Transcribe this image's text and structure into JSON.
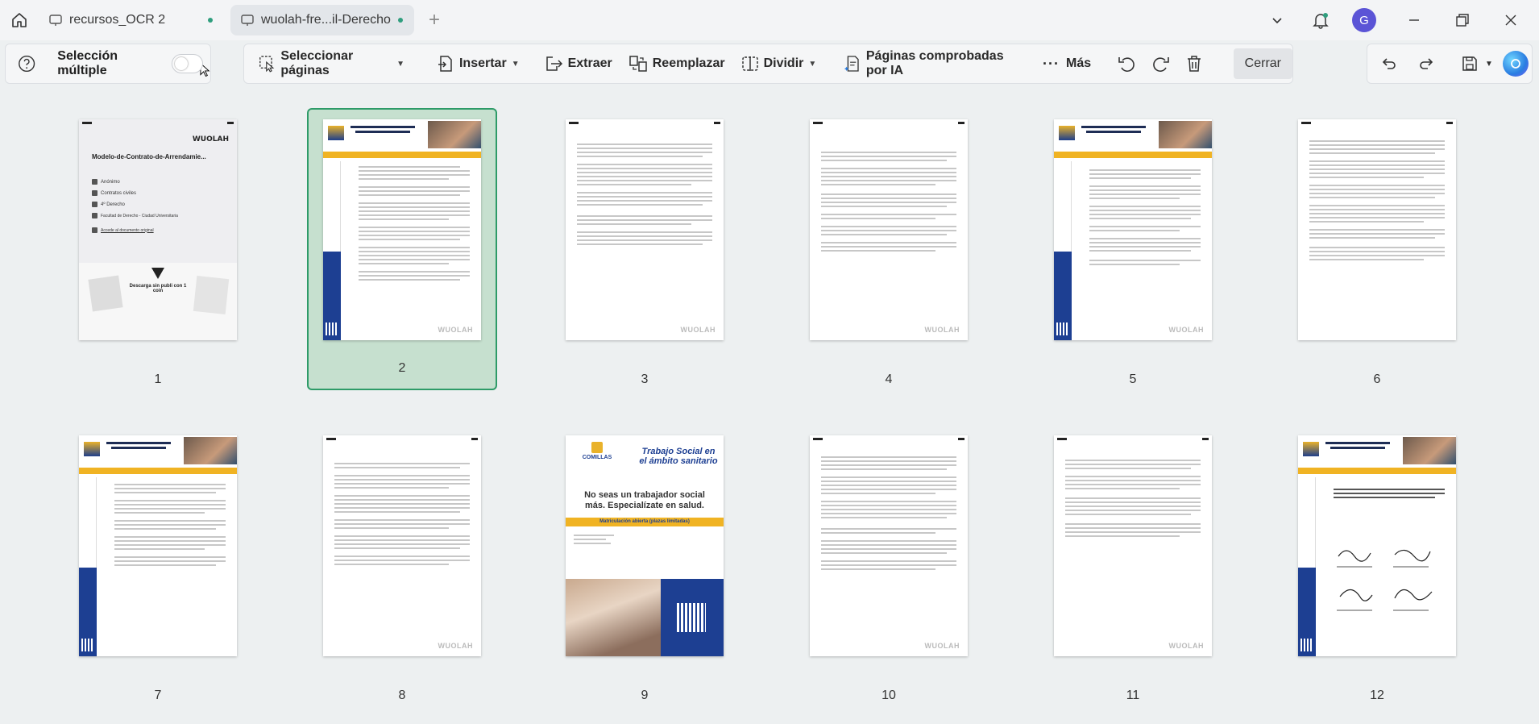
{
  "tabs": [
    {
      "label": "recursos_OCR 2"
    },
    {
      "label": "wuolah-fre...il-Derecho"
    }
  ],
  "avatar_letter": "G",
  "toolbar": {
    "multi_select_label": "Selección múltiple",
    "select_pages": "Seleccionar páginas",
    "insert": "Insertar",
    "extract": "Extraer",
    "replace": "Reemplazar",
    "split": "Dividir",
    "ai_pages": "Páginas comprobadas por IA",
    "more": "Más",
    "close": "Cerrar"
  },
  "pages": [
    {
      "number": "1"
    },
    {
      "number": "2"
    },
    {
      "number": "3"
    },
    {
      "number": "4"
    },
    {
      "number": "5"
    },
    {
      "number": "6"
    },
    {
      "number": "7"
    },
    {
      "number": "8"
    },
    {
      "number": "9"
    },
    {
      "number": "10"
    },
    {
      "number": "11"
    },
    {
      "number": "12"
    }
  ],
  "cover": {
    "brand": "WUOLAH",
    "title": "Modelo-de-Contrato-de-Arrendamie...",
    "items": [
      "Anónimo",
      "Contratos civiles",
      "4º Derecho",
      "Facultad de Derecho - Ciudad Universitaria",
      "Accede al documento original"
    ],
    "footer_text": "Descarga sin publi con 1 coin"
  },
  "ad_page": {
    "brand": "COMILLAS",
    "program": "Trabajo Social en el ámbito sanitario",
    "headline": "No seas un trabajador social más. Especialízate en salud.",
    "band": "Matriculación abierta (plazas limitadas)"
  },
  "colors": {
    "selected_border": "#2e9b68",
    "selected_fill": "#c6e0cf",
    "accent_yellow": "#f0b323",
    "ad_blue": "#1d3f92"
  }
}
